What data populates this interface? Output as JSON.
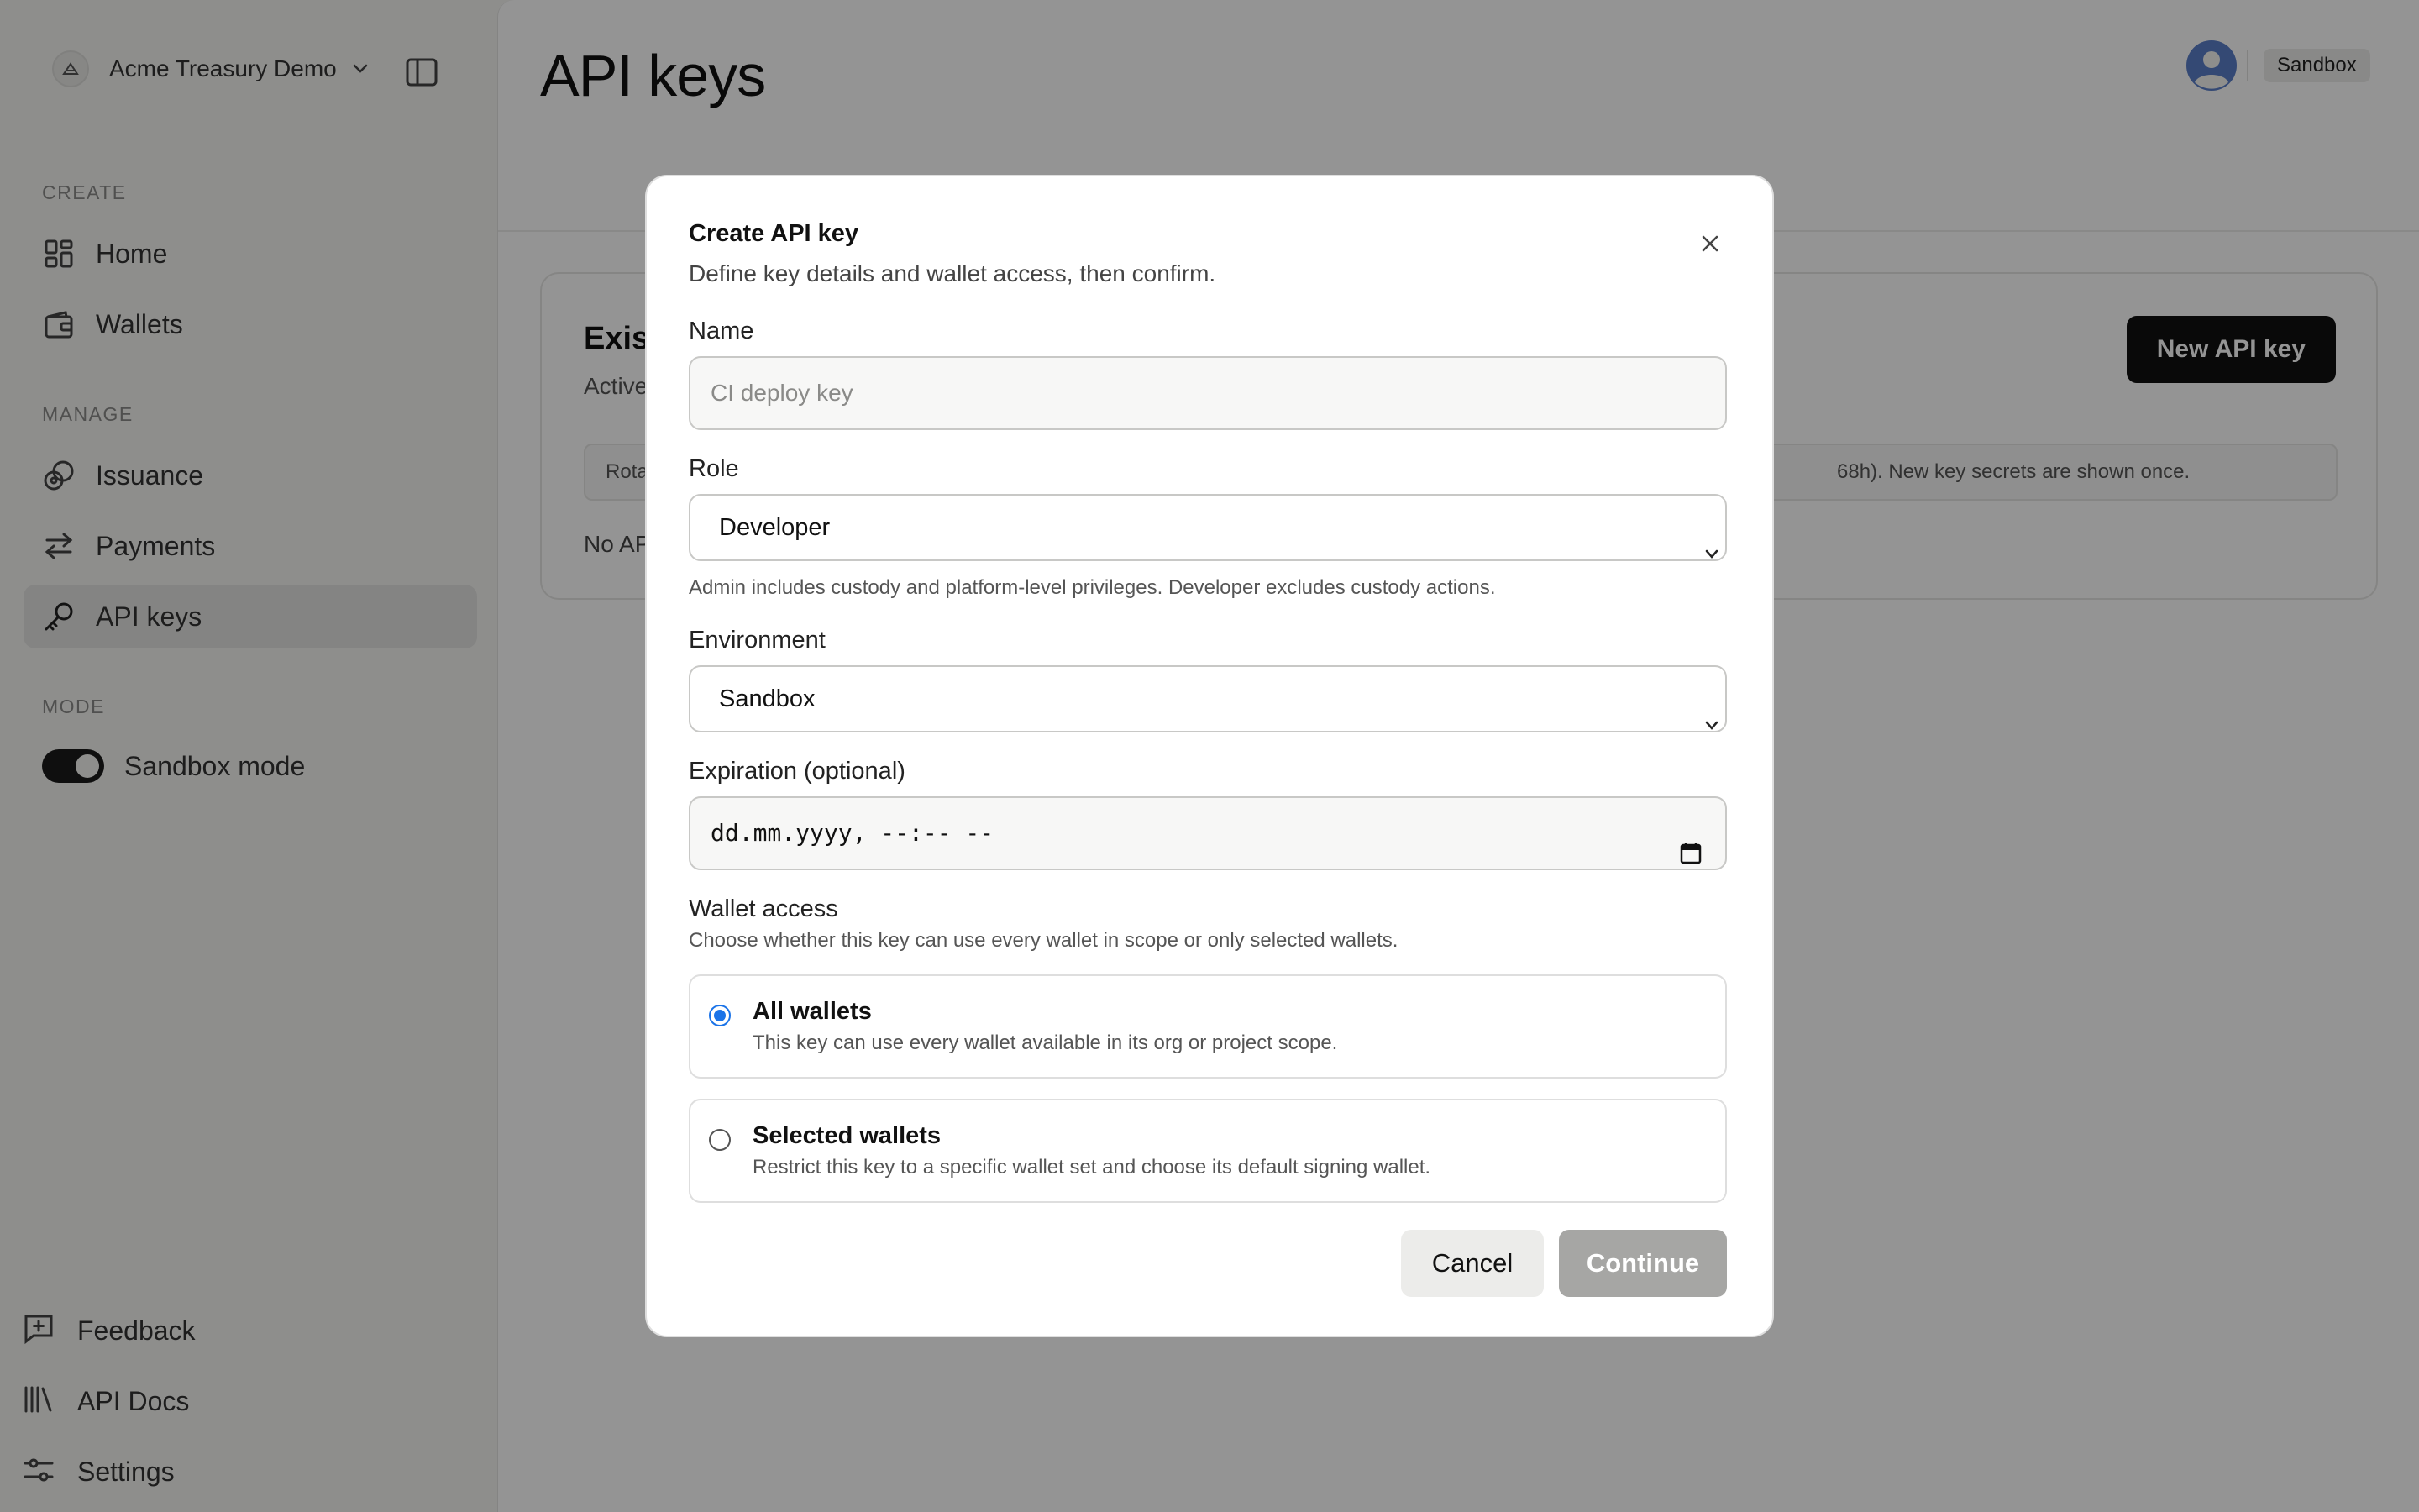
{
  "sidebar": {
    "org_name": "Acme Treasury Demo",
    "sections": {
      "create": "CREATE",
      "manage": "MANAGE",
      "mode": "MODE"
    },
    "items": [
      {
        "label": "Home",
        "icon": "grid-icon"
      },
      {
        "label": "Wallets",
        "icon": "wallet-icon"
      },
      {
        "label": "Issuance",
        "icon": "coins-icon"
      },
      {
        "label": "Payments",
        "icon": "arrows-swap-icon"
      },
      {
        "label": "API keys",
        "icon": "key-icon",
        "active": true
      }
    ],
    "mode_toggle": {
      "label": "Sandbox mode",
      "on": true
    },
    "footer": [
      {
        "label": "Feedback",
        "icon": "feedback-icon"
      },
      {
        "label": "API Docs",
        "icon": "library-icon"
      },
      {
        "label": "Settings",
        "icon": "sliders-icon"
      }
    ]
  },
  "header": {
    "title": "API keys",
    "env_badge": "Sandbox"
  },
  "card": {
    "title": "Exist",
    "subtitle": "Active",
    "new_button": "New API key",
    "notice_start": "Rota",
    "notice_end": "68h). New key secrets are shown once.",
    "empty": "No AP"
  },
  "modal": {
    "title": "Create API key",
    "subtitle": "Define key details and wallet access, then confirm.",
    "name_label": "Name",
    "name_placeholder": "CI deploy key",
    "role_label": "Role",
    "role_value": "Developer",
    "role_hint": "Admin includes custody and platform-level privileges. Developer excludes custody actions.",
    "env_label": "Environment",
    "env_value": "Sandbox",
    "expiration_label": "Expiration (optional)",
    "expiration_value": "dd.mm.yyyy, --:-- --",
    "wallet_access_title": "Wallet access",
    "wallet_access_hint": "Choose whether this key can use every wallet in scope or only selected wallets.",
    "options": [
      {
        "title": "All wallets",
        "desc": "This key can use every wallet available in its org or project scope.",
        "checked": true
      },
      {
        "title": "Selected wallets",
        "desc": "Restrict this key to a specific wallet set and choose its default signing wallet.",
        "checked": false
      }
    ],
    "cancel": "Cancel",
    "continue": "Continue"
  },
  "colors": {
    "accent_radio": "#1a73e8",
    "primary_button": "#111111",
    "disabled_button": "#a6a6a4"
  }
}
